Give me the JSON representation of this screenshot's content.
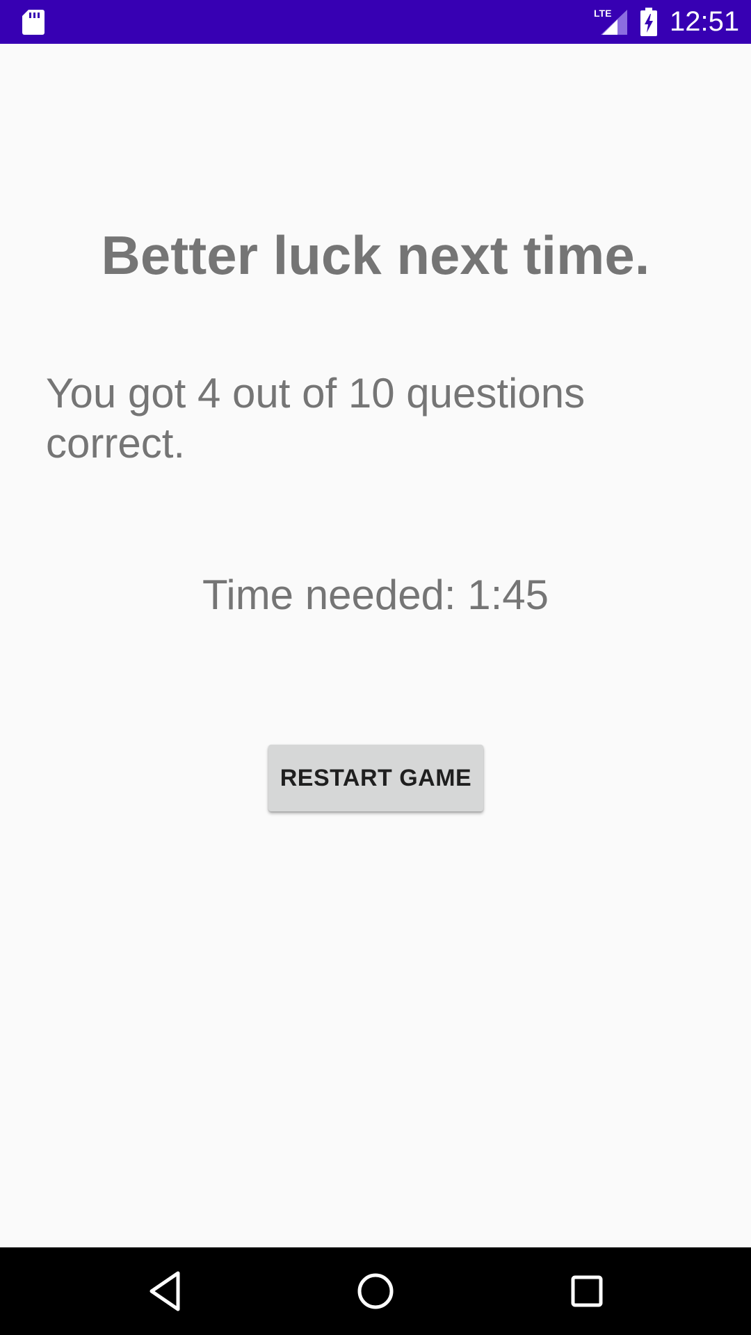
{
  "status_bar": {
    "time": "12:51",
    "network_label": "LTE",
    "background_color": "#3700b3",
    "icons": [
      "sd-card-icon",
      "lte-signal-icon",
      "battery-charging-icon"
    ]
  },
  "result": {
    "title": "Better luck next time.",
    "score_message": "You got 4 out of 10 questions correct.",
    "time_message": "Time needed: 1:45"
  },
  "actions": {
    "restart_label": "RESTART GAME"
  },
  "nav_bar": {
    "icons": [
      "back-icon",
      "home-icon",
      "recents-icon"
    ]
  }
}
